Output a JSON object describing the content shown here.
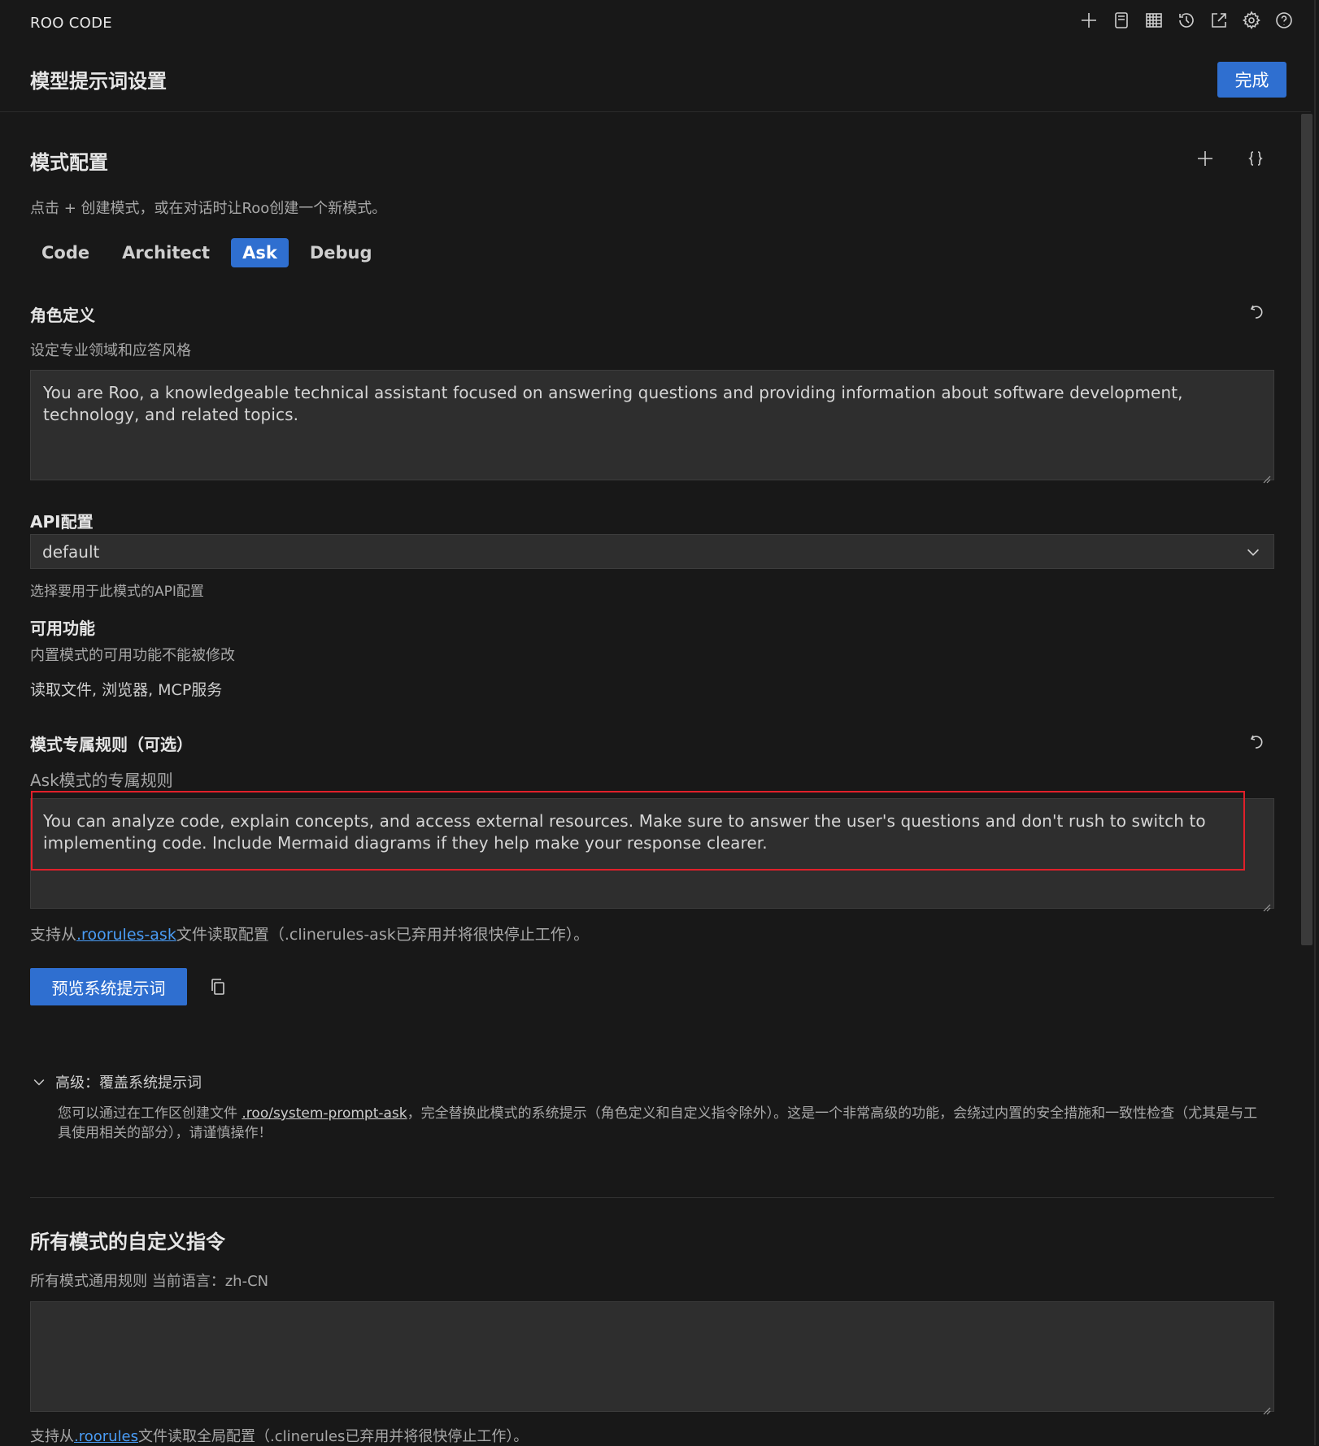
{
  "app": {
    "title": "ROO CODE"
  },
  "toolbar": {
    "icons": [
      "plus-icon",
      "document-icon",
      "server-icon",
      "history-icon",
      "external-link-icon",
      "gear-icon",
      "help-icon"
    ]
  },
  "header": {
    "title": "模型提示词设置",
    "done_label": "完成"
  },
  "modes": {
    "title": "模式配置",
    "description": "点击 + 创建模式，或在对话时让Roo创建一个新模式。",
    "tabs": [
      {
        "label": "Code",
        "active": false
      },
      {
        "label": "Architect",
        "active": false
      },
      {
        "label": "Ask",
        "active": true
      },
      {
        "label": "Debug",
        "active": false
      }
    ]
  },
  "role": {
    "title": "角色定义",
    "description": "设定专业领域和应答风格",
    "value": "You are Roo, a knowledgeable technical assistant focused on answering questions and providing information about software development, technology, and related topics."
  },
  "api": {
    "title": "API配置",
    "selected": "default",
    "hint": "选择要用于此模式的API配置"
  },
  "features": {
    "title": "可用功能",
    "description": "内置模式的可用功能不能被修改",
    "list": "读取文件, 浏览器, MCP服务"
  },
  "rules": {
    "title": "模式专属规则（可选）",
    "description": "Ask模式的专属规则",
    "value": "You can analyze code, explain concepts, and access external resources. Make sure to answer the user's questions and don't rush to switch to implementing code. Include Mermaid diagrams if they help make your response clearer.",
    "support_prefix": "支持从",
    "support_link": ".roorules-ask",
    "support_suffix": "文件读取配置（.clinerules-ask已弃用并将很快停止工作）。"
  },
  "preview": {
    "label": "预览系统提示词"
  },
  "advanced": {
    "title": "高级：覆盖系统提示词",
    "text_prefix": "您可以通过在工作区创建文件 ",
    "text_link": ".roo/system-prompt-ask",
    "text_suffix": "，完全替换此模式的系统提示（角色定义和自定义指令除外）。这是一个非常高级的功能，会绕过内置的安全措施和一致性检查（尤其是与工具使用相关的部分），请谨慎操作！"
  },
  "global": {
    "title": "所有模式的自定义指令",
    "description": "所有模式通用规则 当前语言：zh-CN",
    "value": "",
    "support_prefix": "支持从",
    "support_link": ".roorules",
    "support_suffix": "文件读取全局配置（.clinerules已弃用并将很快停止工作）。"
  },
  "colors": {
    "accent": "#2f6fd0",
    "background": "#181818",
    "input": "#2e2e2e",
    "highlight": "#e0202a",
    "link": "#4a9cf5"
  }
}
